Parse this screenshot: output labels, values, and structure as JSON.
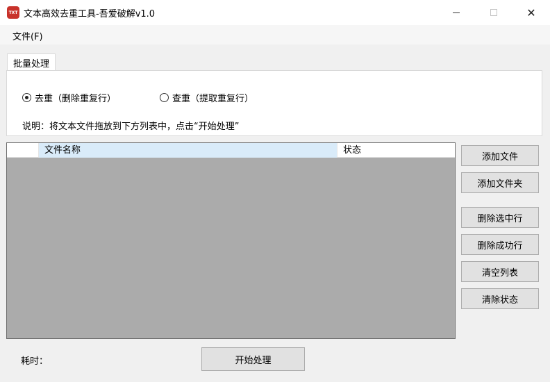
{
  "window": {
    "icon_text": "TXT",
    "title": "文本高效去重工具-吾爱破解v1.0",
    "close_glyph": "✕"
  },
  "menu": {
    "file": "文件(F)"
  },
  "tab": {
    "label": "批量处理"
  },
  "options": {
    "dedupe": {
      "label": "去重（删除重复行）",
      "selected": true
    },
    "find_dupes": {
      "label": "查重（提取重复行）",
      "selected": false
    }
  },
  "hint": "说明：将文本文件拖放到下方列表中，点击“开始处理”",
  "list": {
    "columns": [
      "",
      "文件名称",
      "状态"
    ],
    "rows": []
  },
  "side_buttons": {
    "add_file": "添加文件",
    "add_folder": "添加文件夹",
    "delete_selected": "删除选中行",
    "delete_success": "删除成功行",
    "clear_list": "清空列表",
    "clear_status": "清除状态"
  },
  "footer": {
    "elapsed_label": "耗时：",
    "start_button": "开始处理"
  }
}
